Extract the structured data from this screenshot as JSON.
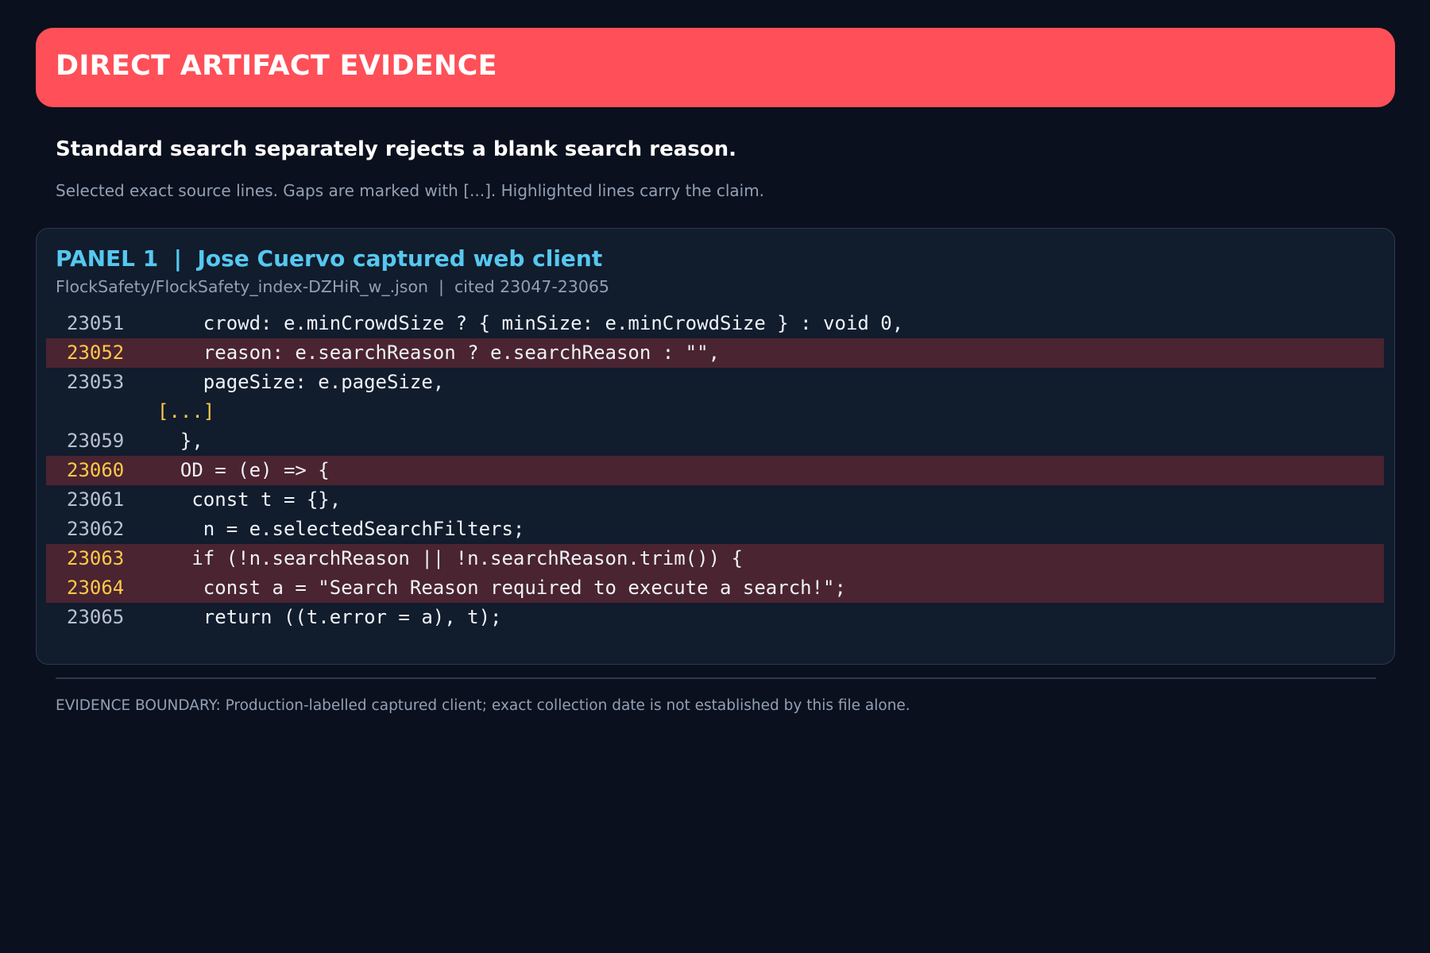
{
  "banner": {
    "title": "DIRECT ARTIFACT EVIDENCE"
  },
  "headline": "Standard search separately rejects a blank search reason.",
  "subline": "Selected exact source lines. Gaps are marked with [...]. Highlighted lines carry the claim.",
  "panel": {
    "title": "PANEL 1  |  Jose Cuervo captured web client",
    "meta": "FlockSafety/FlockSafety_index-DZHiR_w_.json  |  cited 23047-23065",
    "lines": [
      {
        "num": "23051",
        "code": "    crowd: e.minCrowdSize ? { minSize: e.minCrowdSize } : void 0,",
        "highlight": false
      },
      {
        "num": "23052",
        "code": "    reason: e.searchReason ? e.searchReason : \"\",",
        "highlight": true
      },
      {
        "num": "23053",
        "code": "    pageSize: e.pageSize,",
        "highlight": false
      },
      {
        "num": "",
        "code": "[...]",
        "highlight": false,
        "gap": true
      },
      {
        "num": "23059",
        "code": "  },",
        "highlight": false
      },
      {
        "num": "23060",
        "code": "  OD = (e) => {",
        "highlight": true
      },
      {
        "num": "23061",
        "code": "   const t = {},",
        "highlight": false
      },
      {
        "num": "23062",
        "code": "    n = e.selectedSearchFilters;",
        "highlight": false
      },
      {
        "num": "23063",
        "code": "   if (!n.searchReason || !n.searchReason.trim()) {",
        "highlight": true
      },
      {
        "num": "23064",
        "code": "    const a = \"Search Reason required to execute a search!\";",
        "highlight": true
      },
      {
        "num": "23065",
        "code": "    return ((t.error = a), t);",
        "highlight": false
      }
    ]
  },
  "footnote": "EVIDENCE BOUNDARY: Production-labelled captured client; exact collection date is not established by this file alone.",
  "colors": {
    "background": "#0a101d",
    "banner": "#ff4f58",
    "panel_title": "#56c8ef",
    "highlight_row": "#4a2430",
    "highlight_number": "#ffc94a",
    "gap_marker": "#ffc94a"
  }
}
